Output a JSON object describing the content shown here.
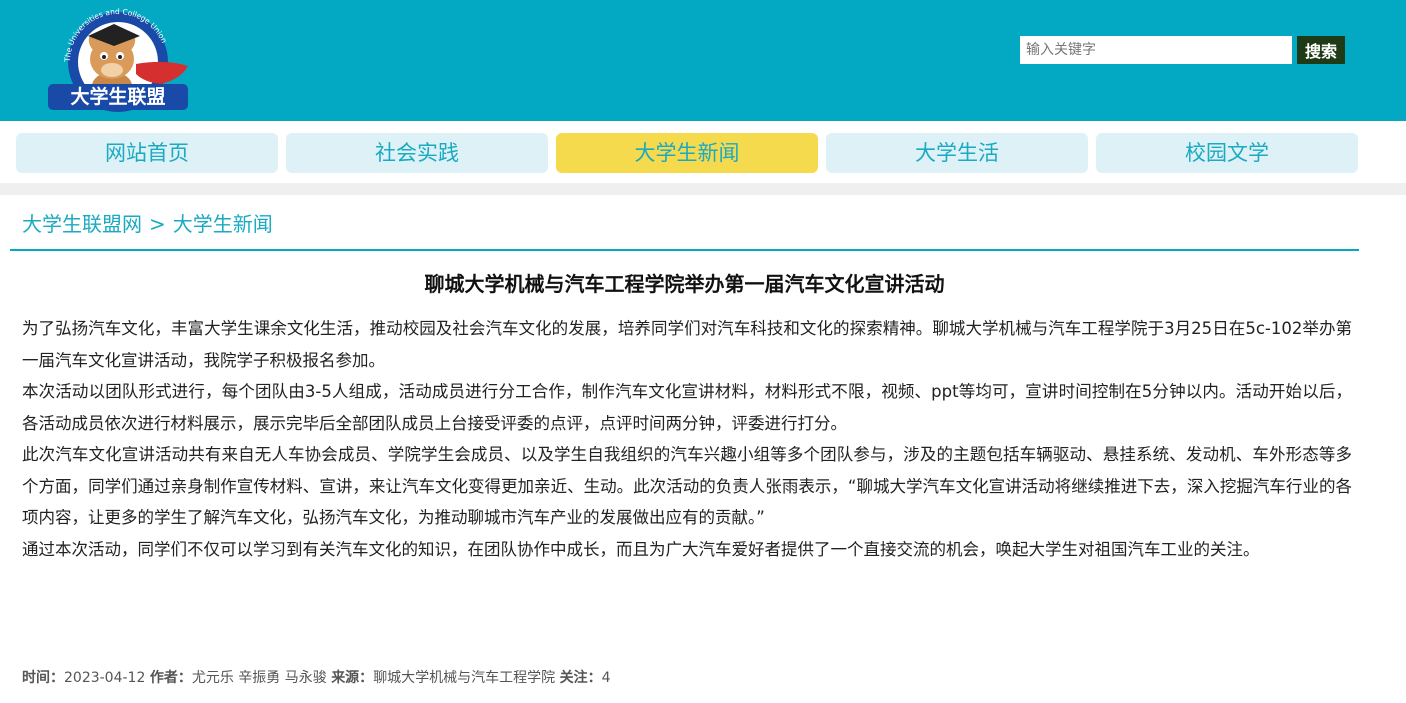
{
  "header": {
    "logo_text": "大学生联盟",
    "logo_ring_text": "The Universities and College Union",
    "search": {
      "placeholder": "输入关键字",
      "value": ""
    },
    "search_button": "搜索"
  },
  "nav": {
    "items": [
      {
        "label": "网站首页",
        "active": false
      },
      {
        "label": "社会实践",
        "active": false
      },
      {
        "label": "大学生新闻",
        "active": true
      },
      {
        "label": "大学生活",
        "active": false
      },
      {
        "label": "校园文学",
        "active": false
      }
    ]
  },
  "breadcrumb": {
    "home": "大学生联盟网",
    "separator": ">",
    "current": "大学生新闻"
  },
  "article": {
    "title": "聊城大学机械与汽车工程学院举办第一届汽车文化宣讲活动",
    "paragraphs": [
      "为了弘扬汽车文化，丰富大学生课余文化生活，推动校园及社会汽车文化的发展，培养同学们对汽车科技和文化的探索精神。聊城大学机械与汽车工程学院于3月25日在5c-102举办第一届汽车文化宣讲活动，我院学子积极报名参加。",
      "本次活动以团队形式进行，每个团队由3-5人组成，活动成员进行分工合作，制作汽车文化宣讲材料，材料形式不限，视频、ppt等均可，宣讲时间控制在5分钟以内。活动开始以后，各活动成员依次进行材料展示，展示完毕后全部团队成员上台接受评委的点评，点评时间两分钟，评委进行打分。",
      "此次汽车文化宣讲活动共有来自无人车协会成员、学院学生会成员、以及学生自我组织的汽车兴趣小组等多个团队参与，涉及的主题包括车辆驱动、悬挂系统、发动机、车外形态等多个方面，同学们通过亲身制作宣传材料、宣讲，来让汽车文化变得更加亲近、生动。此次活动的负责人张雨表示，“聊城大学汽车文化宣讲活动将继续推进下去，深入挖掘汽车行业的各项内容，让更多的学生了解汽车文化，弘扬汽车文化，为推动聊城市汽车产业的发展做出应有的贡献。”",
      "通过本次活动，同学们不仅可以学习到有关汽车文化的知识，在团队协作中成长，而且为广大汽车爱好者提供了一个直接交流的机会，唤起大学生对祖国汽车工业的关注。"
    ],
    "meta": {
      "time_label": "时间：",
      "time": "2023-04-12",
      "author_label": "作者：",
      "author": "尤元乐 辛振勇 马永骏",
      "source_label": "来源：",
      "source": "聊城大学机械与汽车工程学院",
      "views_label": "关注：",
      "views": "4"
    }
  },
  "colors": {
    "header_bg": "#03a9c3",
    "nav_bg": "#ddf1f6",
    "nav_active_bg": "#f6da4e",
    "nav_text": "#1aaac2",
    "search_button_bg": "#1e3a16"
  }
}
